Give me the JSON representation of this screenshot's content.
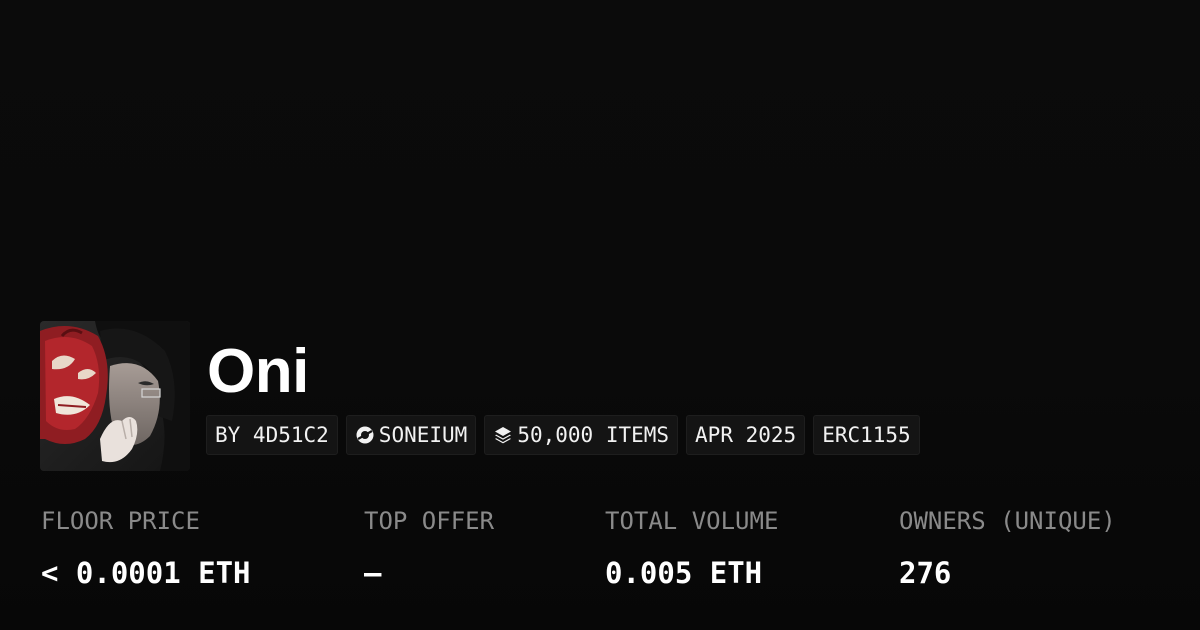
{
  "collection": {
    "name": "Oni",
    "avatar_icon": "oni-mask-artwork"
  },
  "tags": {
    "creator": "BY 4D51C2",
    "chain": "SONEIUM",
    "chain_icon": "soneium-logo-icon",
    "items": "50,000 ITEMS",
    "items_icon": "layers-icon",
    "date": "APR 2025",
    "standard": "ERC1155"
  },
  "stats": {
    "floor_price": {
      "label": "FLOOR PRICE",
      "value": "< 0.0001 ETH"
    },
    "top_offer": {
      "label": "TOP OFFER",
      "value": "—"
    },
    "total_volume": {
      "label": "TOTAL VOLUME",
      "value": "0.005 ETH"
    },
    "owners": {
      "label": "OWNERS (UNIQUE)",
      "value": "276"
    }
  },
  "colors": {
    "background": "#0a0a0a",
    "tag_background": "#141414",
    "label_gray": "#8a8a8a",
    "text_white": "#ffffff",
    "mask_red": "#b3262c"
  }
}
